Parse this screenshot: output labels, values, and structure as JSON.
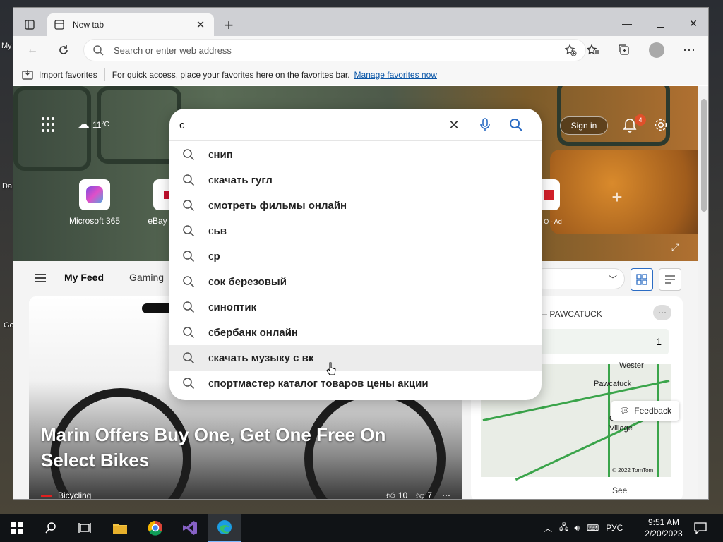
{
  "desktop": {
    "labels": [
      "My",
      "Da",
      "Go"
    ]
  },
  "browser": {
    "tab": {
      "title": "New tab"
    },
    "address": {
      "placeholder": "Search or enter web address"
    },
    "favbar": {
      "import_label": "Import favorites",
      "hint": "For quick access, place your favorites here on the favorites bar.",
      "manage_link": "Manage favorites now"
    }
  },
  "newtab": {
    "weather_temp": "11",
    "weather_unit": "°C",
    "signin_label": "Sign in",
    "notification_count": "4",
    "tiles": [
      {
        "label": "Microsoft 365"
      },
      {
        "label": "eBay"
      },
      {
        "label": "O - Ad"
      }
    ],
    "feed_tabs": [
      "My Feed",
      "Gaming"
    ],
    "article": {
      "headline": "Marin Offers Buy One, Get One Free On Select Bikes",
      "source": "Bicycling",
      "likes": "10",
      "dislikes": "7"
    },
    "weather_card": {
      "location": "— PAWCATUCK",
      "value": "1",
      "map_labels": [
        "Wester",
        "Pawcatuck",
        "Clarks Village",
        "© 2022 TomTom",
        "See"
      ]
    },
    "feedback_label": "Feedback"
  },
  "search": {
    "query": "с",
    "suggestions": [
      {
        "prefix": "с",
        "rest": "нип"
      },
      {
        "prefix": "с",
        "rest": "качать гугл"
      },
      {
        "prefix": "с",
        "rest": "мотреть фильмы онлайн"
      },
      {
        "prefix": "с",
        "rest": "ьв"
      },
      {
        "prefix": "с",
        "rest": "р"
      },
      {
        "prefix": "с",
        "rest": "ок березовый"
      },
      {
        "prefix": "с",
        "rest": "иноптик"
      },
      {
        "prefix": "с",
        "rest": "бербанк онлайн"
      },
      {
        "prefix": "с",
        "rest": "качать музыку с вк"
      },
      {
        "prefix": "с",
        "rest": "портмастер каталог товаров цены акции"
      }
    ],
    "highlighted_index": 8
  },
  "taskbar": {
    "lang": "РУС",
    "time": "9:51 AM",
    "date": "2/20/2023"
  },
  "colors": {
    "accent": "#2b6cc4",
    "link": "#0b57a8",
    "badge": "#e0502a",
    "taskbar": "#101316"
  }
}
